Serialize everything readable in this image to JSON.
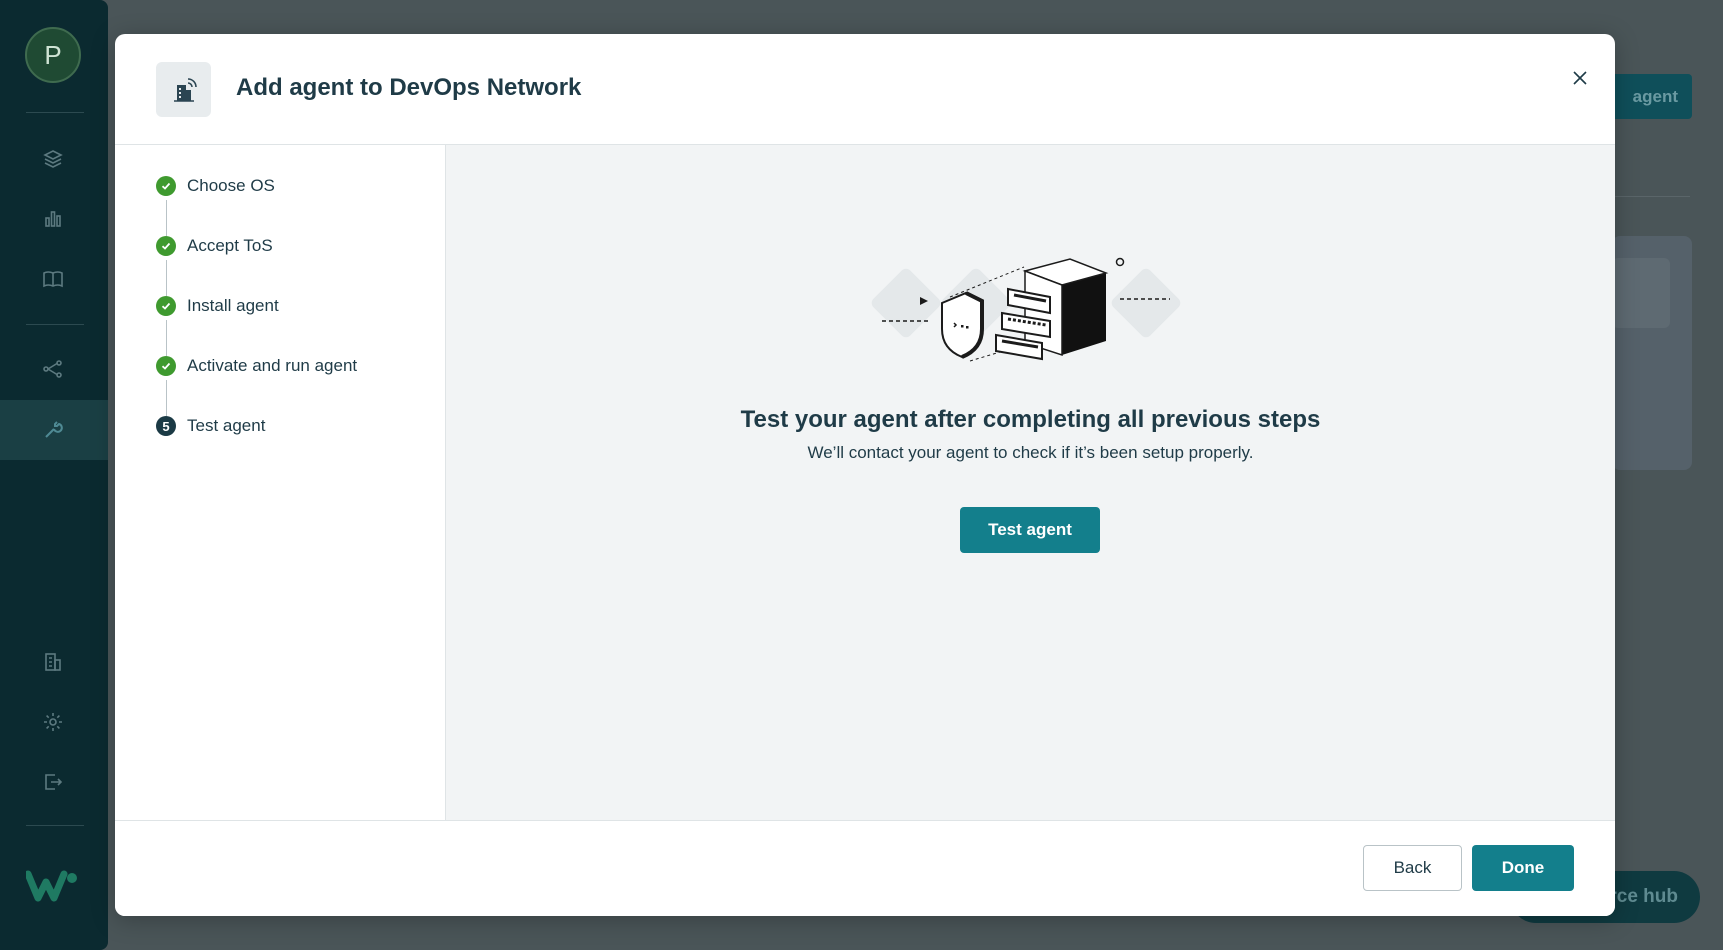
{
  "background": {
    "avatar_initial": "P",
    "header_button_label": "agent",
    "resource_hub_label": "rce hub",
    "sidebar_icons": [
      "layers-icon",
      "bar-chart-icon",
      "book-icon",
      "share-nodes-icon",
      "wrench-icon",
      "building-icon",
      "gear-icon",
      "logout-icon"
    ]
  },
  "modal": {
    "title": "Add agent to DevOps Network",
    "header_icon": "network-building-icon",
    "close_icon": "close-icon",
    "steps": [
      {
        "number": "1",
        "label": "Choose OS",
        "status": "done"
      },
      {
        "number": "2",
        "label": "Accept ToS",
        "status": "done"
      },
      {
        "number": "3",
        "label": "Install agent",
        "status": "done"
      },
      {
        "number": "4",
        "label": "Activate and run agent",
        "status": "done"
      },
      {
        "number": "5",
        "label": "Test agent",
        "status": "current"
      }
    ],
    "content": {
      "heading": "Test your agent after completing all previous steps",
      "subtext": "We’ll contact your agent to check if it’s been setup properly.",
      "test_button_label": "Test agent",
      "illustration": "shield-and-server-illustration"
    },
    "footer": {
      "back_label": "Back",
      "done_label": "Done"
    }
  },
  "colors": {
    "primary": "#137f8c",
    "success": "#3f9a2f",
    "text": "#1f3b47",
    "sidebar": "#0b2a30"
  }
}
